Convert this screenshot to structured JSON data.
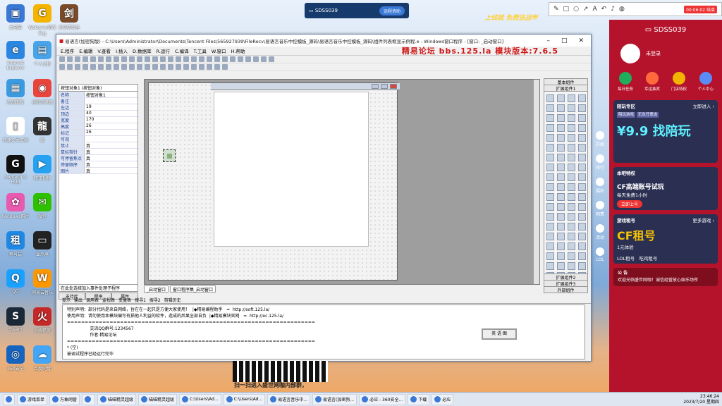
{
  "desktop_icons": [
    {
      "label": "此电脑",
      "color": "#3a78d6",
      "glyph": "▣"
    },
    {
      "label": "WeGame游戏平台",
      "color": "#f4b400",
      "glyph": "G"
    },
    {
      "label": "剑侠情缘叁",
      "color": "#7a4b2a",
      "glyph": "剑"
    },
    {
      "label": "Internet Explorer",
      "color": "#2a86e0",
      "glyph": "e"
    },
    {
      "label": "个人文档",
      "color": "#49a3e8",
      "glyph": "▤"
    },
    {
      "label": "控制面板",
      "color": "#3b9be0",
      "glyph": "▦"
    },
    {
      "label": "谷歌浏览器",
      "color": "#e8453c",
      "glyph": "◉"
    },
    {
      "label": "新建文本文档",
      "color": "#ffffff",
      "glyph": "▯"
    },
    {
      "label": "龍",
      "color": "#333333",
      "glyph": "龍"
    },
    {
      "label": "Logitech G HUB",
      "color": "#111111",
      "glyph": "G"
    },
    {
      "label": "腾讯视频",
      "color": "#27a2f0",
      "glyph": "▶"
    },
    {
      "label": "Windows照片",
      "color": "#e85ab0",
      "glyph": "✿"
    },
    {
      "label": "微信",
      "color": "#2dc100",
      "glyph": "✉"
    },
    {
      "label": "租号玩",
      "color": "#1e88e5",
      "glyph": "租"
    },
    {
      "label": "显示器",
      "color": "#222222",
      "glyph": "▭"
    },
    {
      "label": "QQ",
      "color": "#1aa1ff",
      "glyph": "Q"
    },
    {
      "label": "网易云音乐",
      "color": "#ff9800",
      "glyph": "W"
    },
    {
      "label": "Steam",
      "color": "#1b2838",
      "glyph": "S"
    },
    {
      "label": "火线精英",
      "color": "#c62828",
      "glyph": "火"
    },
    {
      "label": "360安全",
      "color": "#1565c0",
      "glyph": "◎"
    },
    {
      "label": "百度网盘",
      "color": "#42a5f5",
      "glyph": "☁"
    }
  ],
  "topbar": {
    "name": "SDSS039",
    "button": "远程协助"
  },
  "recbar": {
    "timer": "00:06:02",
    "stop": "结束"
  },
  "ad_strip": "上线就 免费送战甲",
  "window": {
    "title": "易语言(加密狗版) - C:\\Users\\Administrator\\Documents\\Tencent Files\\565927939\\FileRecv\\易语言音乐中控模板_源码\\易语言音乐中控模板_源码\\组件列表框显示例程.e - Windows窗口程序 - [窗口: _启动窗口]",
    "menu": [
      "E.程序",
      "E.编辑",
      "V.查看",
      "I.插入",
      "D.数据库",
      "R.运行",
      "C.编译",
      "T.工具",
      "W.窗口",
      "H.帮助"
    ],
    "brand": "精易论坛  bbs.125.la  模块版本:7.6.5",
    "props": {
      "selector": "按钮对象1 (按钮对象)",
      "rows": [
        {
          "k": "名称",
          "v": "按钮对象1"
        },
        {
          "k": "备注",
          "v": ""
        },
        {
          "k": "左边",
          "v": "19"
        },
        {
          "k": "顶边",
          "v": "40"
        },
        {
          "k": "宽度",
          "v": "170"
        },
        {
          "k": "高度",
          "v": "26"
        },
        {
          "k": "标记",
          "v": "26"
        },
        {
          "k": "可视",
          "v": ""
        },
        {
          "k": "禁止",
          "v": "真"
        },
        {
          "k": "鼠标指针",
          "v": "真"
        },
        {
          "k": "可停留焦点",
          "v": "真"
        },
        {
          "k": "停留顺序",
          "v": "真"
        },
        {
          "k": "图片",
          "v": "真"
        }
      ],
      "event_hint": "在此处选择加入事件处理子程序",
      "tabs": [
        "支持库",
        "程序",
        "属性"
      ]
    },
    "design_tabs": [
      "_启动窗口",
      "窗口程序集_启动窗口"
    ],
    "toolbox": {
      "title": "基本组件",
      "sub": "扩展组件1",
      "footers": [
        "扩展组件2",
        "扩展组件3",
        "外部组件"
      ]
    },
    "bottom_tabs": [
      "提示",
      "输出",
      "调用表",
      "监视表",
      "变量表",
      "搜寻1",
      "搜寻2",
      "剪辑历史"
    ],
    "output_lines": [
      "特别声明：部分代码是来自网络，旨在在一起只是方便大家使用！  |◆精易编程助手   =  http://soft.125.la/",
      "使用声明：请勿使用本模块编写有损他人利益的软件，造成的后果全部自负  |◆精易模块官网   =  http://ec.125.la/",
      "======================================================================",
      "                 交流QQ群号:1234567",
      "                 作者:精易论坛 ",
      "======================================================================",
      "* (空)",
      "被调试程序已经运行完毕"
    ]
  },
  "side": {
    "title": "SDSS039",
    "login": "未登录",
    "actions": [
      {
        "label": "每日任务",
        "color": "#1fae5b"
      },
      {
        "label": "幸运抽奖",
        "color": "#ff6a3d"
      },
      {
        "label": "门店特权",
        "color": "#f2b400"
      },
      {
        "label": "个人中心",
        "color": "#5b8cf5"
      }
    ],
    "card1": {
      "title": "陪玩专区",
      "link": "立即进入 ›",
      "tags": [
        "陪玩游戏",
        "无及任意选"
      ],
      "promo": "¥9.9 找陪玩"
    },
    "card2": {
      "title": "本吧特权",
      "promo": "CF高端账号试玩",
      "sub": "每天免费1小时",
      "btn": "立即上号"
    },
    "card3": {
      "title": "游戏租号",
      "link": "更多游戏 ›",
      "promo": "CF租号",
      "sub": "1元体验",
      "items": [
        "LOL租号",
        "吃鸡租号"
      ]
    },
    "notice": {
      "title": "公 告",
      "text": "欢迎光临盛世网咖！诚信经营放心娱乐场所"
    }
  },
  "dock": [
    "开始",
    "排行",
    "福利",
    "网费",
    "活动",
    "LOL"
  ],
  "qr_text": "扫一扫进入盛世网咖内部群，",
  "stamp": "英 语 图",
  "taskbar": {
    "items": [
      "游戏菜单",
      "万象网管",
      "",
      "喵喵精灵超级",
      "喵喵精灵超级",
      "C:\\Users\\Ad...",
      "C:\\Users\\Ad...",
      "易语言音乐中...",
      "易语言(加密狗...",
      "必应 - 360安全...",
      "下载",
      "必应"
    ],
    "time": "23:46:24",
    "date": "2023/7/20 星期四"
  }
}
